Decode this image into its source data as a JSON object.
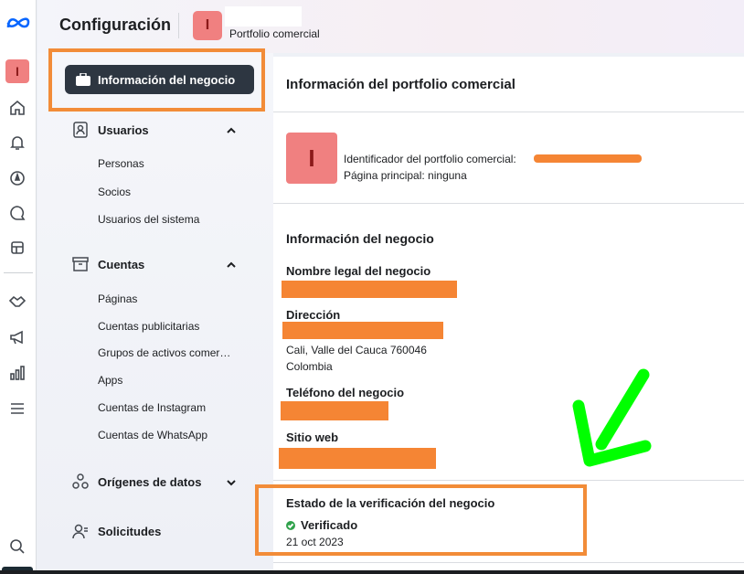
{
  "app": {
    "title": "Configuración",
    "portfolio_initial": "I",
    "portfolio_name": "Portfolio comercial"
  },
  "rail": {
    "icons": [
      "meta-logo-icon",
      "home-icon",
      "bell-icon",
      "compass-icon",
      "chat-icon",
      "pages-icon",
      "handshake-icon",
      "megaphone-icon",
      "chart-icon",
      "menu-icon",
      "search-icon"
    ]
  },
  "sidebar": {
    "active_item": "Información del negocio",
    "sections": [
      {
        "label": "Usuarios",
        "expanded": true,
        "items": [
          "Personas",
          "Socios",
          "Usuarios del sistema"
        ]
      },
      {
        "label": "Cuentas",
        "expanded": true,
        "items": [
          "Páginas",
          "Cuentas publicitarias",
          "Grupos de activos comer…",
          "Apps",
          "Cuentas de Instagram",
          "Cuentas de WhatsApp"
        ]
      },
      {
        "label": "Orígenes de datos",
        "expanded": false,
        "items": []
      },
      {
        "label": "Solicitudes",
        "expanded": false,
        "items": []
      }
    ]
  },
  "main": {
    "title": "Información del portfolio comercial",
    "initial": "I",
    "id_label": "Identificador del portfolio comercial:",
    "main_page": "Página principal: ninguna",
    "business_info_title": "Información del negocio",
    "legal_name_label": "Nombre legal del negocio",
    "address_label": "Dirección",
    "address_line1": "Cali, Valle del Cauca 760046",
    "address_line2": "Colombia",
    "phone_label": "Teléfono del negocio",
    "website_label": "Sitio web",
    "verification_title": "Estado de la verificación del negocio",
    "verification_status": "Verificado",
    "verification_date": "21 oct 2023"
  },
  "colors": {
    "highlight": "#f28c38",
    "redaction": "#f58534",
    "arrow": "#00ff00",
    "verified": "#31a24c",
    "avatar": "#f08080",
    "active_nav": "#2d3641"
  }
}
